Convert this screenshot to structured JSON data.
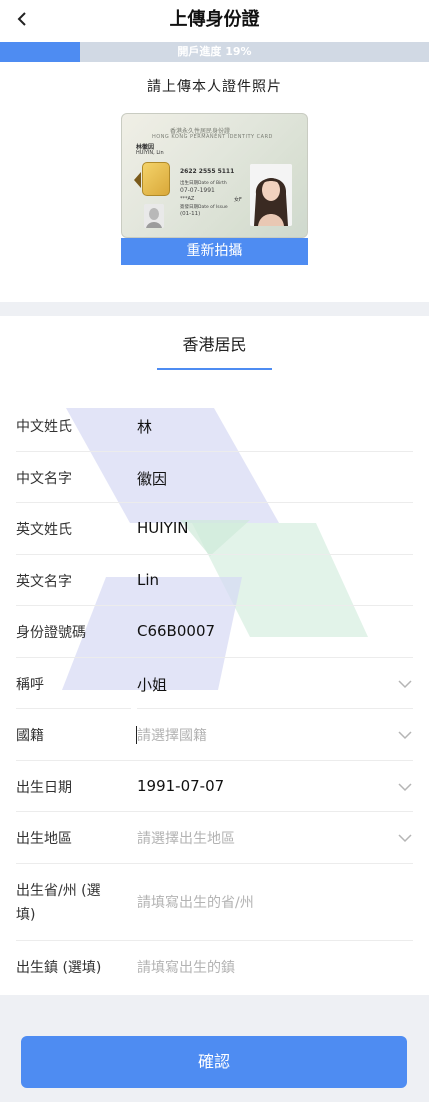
{
  "header": {
    "title": "上傳身份證",
    "back_icon": "chevron-left-icon"
  },
  "progress": {
    "label": "開戶進度 19%",
    "value": 0.19,
    "fill_color": "#4e8cf2",
    "track_color": "#d1d9e4"
  },
  "upload": {
    "instruction": "請上傳本人證件照片",
    "retake_label": "重新拍攝",
    "card": {
      "head_cn": "香港永久性居民身份證",
      "head_en": "HONG KONG PERMANENT IDENTITY CARD",
      "name_cn": "林徽因",
      "name_en": "HUIYIN, Lin",
      "number_line": "2622 2555 5111",
      "dob_label": "出生日期Date of Birth",
      "dob": "07-07-1991",
      "sex": "女F",
      "code": "***AZ",
      "issue_label": "簽發日期Date of Issue",
      "issue": "(01-11)"
    }
  },
  "resident": {
    "title": "香港居民"
  },
  "form": {
    "rows": [
      {
        "label": "中文姓氏",
        "value": "林"
      },
      {
        "label": "中文名字",
        "value": "徽因"
      },
      {
        "label": "英文姓氏",
        "value": "HUIYIN"
      },
      {
        "label": "英文名字",
        "value": "Lin"
      },
      {
        "label": "身份證號碼",
        "value": "C66B0007"
      },
      {
        "label": "稱呼",
        "value": "小姐"
      },
      {
        "label": "國籍",
        "placeholder": "請選擇國籍"
      },
      {
        "label": "出生日期",
        "value": "1991-07-07"
      },
      {
        "label": "出生地區",
        "placeholder": "請選擇出生地區"
      },
      {
        "label_line1": "出生省/州 (選",
        "label_line2": "填)",
        "placeholder": "請填寫出生的省/州"
      },
      {
        "label": "出生鎮 (選填)",
        "placeholder": "請填寫出生的鎮"
      }
    ]
  },
  "confirm_label": "確認",
  "colors": {
    "accent": "#4e8cf2",
    "gray_bg": "#eef0f4"
  }
}
